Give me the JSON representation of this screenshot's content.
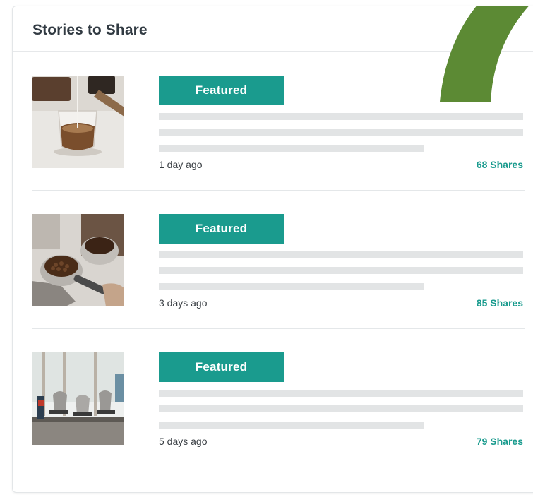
{
  "card": {
    "title": "Stories to Share"
  },
  "colors": {
    "accent_teal": "#1a9b8e",
    "swoosh_green": "#5c8a34",
    "placeholder_gray": "#e2e4e5"
  },
  "stories": [
    {
      "badge": "Featured",
      "time": "1 day ago",
      "shares": "68 Shares",
      "image": "coffee-glass-photo"
    },
    {
      "badge": "Featured",
      "time": "3 days ago",
      "shares": "85 Shares",
      "image": "espresso-portafilter-photo"
    },
    {
      "badge": "Featured",
      "time": "5 days ago",
      "shares": "79 Shares",
      "image": "coffee-bar-photo"
    }
  ]
}
